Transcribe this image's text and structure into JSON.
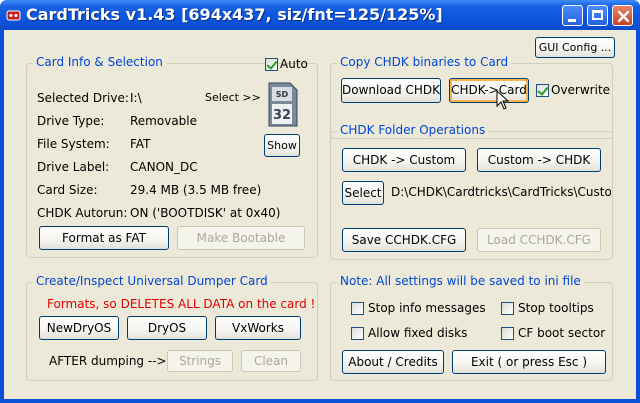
{
  "window": {
    "title": "CardTricks v1.43 [694x437, siz/fnt=125/125%]"
  },
  "gui_config_label": "GUI Config ...",
  "card_info": {
    "title": "Card Info & Selection",
    "auto_label": "Auto",
    "auto_checked": true,
    "select_label": "Select >>",
    "sd_card_text": "32",
    "show_label": "Show",
    "rows": [
      {
        "label": "Selected Drive:",
        "value": "I:\\"
      },
      {
        "label": "Drive Type:",
        "value": "Removable"
      },
      {
        "label": "File System:",
        "value": "FAT"
      },
      {
        "label": "Drive Label:",
        "value": "CANON_DC"
      },
      {
        "label": "Card Size:",
        "value": "29.4 MB  (3.5 MB free)"
      },
      {
        "label": "CHDK Autorun:",
        "value": "ON ('BOOTDISK' at 0x40)"
      }
    ],
    "format_fat_label": "Format as FAT",
    "make_bootable_label": "Make Bootable"
  },
  "copy_chdk": {
    "title": "Copy CHDK binaries to Card",
    "download_label": "Download CHDK",
    "to_card_label": "CHDK->Card",
    "overwrite_label": "Overwrite",
    "overwrite_checked": true
  },
  "folder_ops": {
    "title": "CHDK Folder Operations",
    "chdk_to_custom_label": "CHDK -> Custom",
    "custom_to_chdk_label": "Custom -> CHDK",
    "select_label": "Select",
    "path": "D:\\CHDK\\Cardtricks\\CardTricks\\Custon",
    "save_cfg_label": "Save CCHDK.CFG",
    "load_cfg_label": "Load CCHDK.CFG"
  },
  "dumper": {
    "title": "Create/Inspect Universal Dumper Card",
    "warning": "Formats, so DELETES ALL DATA on the card !",
    "newdryos_label": "NewDryOS",
    "dryos_label": "DryOS",
    "vxworks_label": "VxWorks",
    "after_dumping_label": "AFTER dumping -->",
    "strings_label": "Strings",
    "clean_label": "Clean"
  },
  "settings": {
    "title": "Note: All settings will be saved to ini file",
    "stop_info_label": "Stop info messages",
    "stop_tooltips_label": "Stop tooltips",
    "allow_fixed_label": "Allow fixed disks",
    "cf_boot_label": "CF boot sector",
    "stop_info_checked": false,
    "stop_tooltips_checked": false,
    "allow_fixed_checked": false,
    "cf_boot_checked": false,
    "about_label": "About / Credits",
    "exit_label": "Exit ( or press Esc )"
  },
  "colors": {
    "title_blue": "#0a50d8",
    "group_title": "#0046d5",
    "warning_red": "#e00000",
    "face": "#ece9d8"
  }
}
